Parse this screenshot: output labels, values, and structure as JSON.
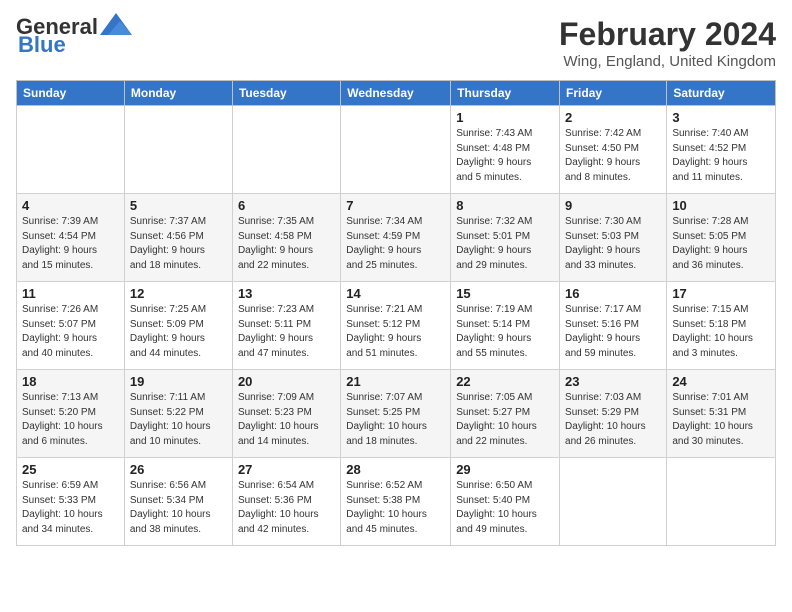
{
  "header": {
    "logo_line1": "General",
    "logo_line2": "Blue",
    "month_title": "February 2024",
    "location": "Wing, England, United Kingdom"
  },
  "weekdays": [
    "Sunday",
    "Monday",
    "Tuesday",
    "Wednesday",
    "Thursday",
    "Friday",
    "Saturday"
  ],
  "weeks": [
    [
      {
        "day": "",
        "info": ""
      },
      {
        "day": "",
        "info": ""
      },
      {
        "day": "",
        "info": ""
      },
      {
        "day": "",
        "info": ""
      },
      {
        "day": "1",
        "info": "Sunrise: 7:43 AM\nSunset: 4:48 PM\nDaylight: 9 hours\nand 5 minutes."
      },
      {
        "day": "2",
        "info": "Sunrise: 7:42 AM\nSunset: 4:50 PM\nDaylight: 9 hours\nand 8 minutes."
      },
      {
        "day": "3",
        "info": "Sunrise: 7:40 AM\nSunset: 4:52 PM\nDaylight: 9 hours\nand 11 minutes."
      }
    ],
    [
      {
        "day": "4",
        "info": "Sunrise: 7:39 AM\nSunset: 4:54 PM\nDaylight: 9 hours\nand 15 minutes."
      },
      {
        "day": "5",
        "info": "Sunrise: 7:37 AM\nSunset: 4:56 PM\nDaylight: 9 hours\nand 18 minutes."
      },
      {
        "day": "6",
        "info": "Sunrise: 7:35 AM\nSunset: 4:58 PM\nDaylight: 9 hours\nand 22 minutes."
      },
      {
        "day": "7",
        "info": "Sunrise: 7:34 AM\nSunset: 4:59 PM\nDaylight: 9 hours\nand 25 minutes."
      },
      {
        "day": "8",
        "info": "Sunrise: 7:32 AM\nSunset: 5:01 PM\nDaylight: 9 hours\nand 29 minutes."
      },
      {
        "day": "9",
        "info": "Sunrise: 7:30 AM\nSunset: 5:03 PM\nDaylight: 9 hours\nand 33 minutes."
      },
      {
        "day": "10",
        "info": "Sunrise: 7:28 AM\nSunset: 5:05 PM\nDaylight: 9 hours\nand 36 minutes."
      }
    ],
    [
      {
        "day": "11",
        "info": "Sunrise: 7:26 AM\nSunset: 5:07 PM\nDaylight: 9 hours\nand 40 minutes."
      },
      {
        "day": "12",
        "info": "Sunrise: 7:25 AM\nSunset: 5:09 PM\nDaylight: 9 hours\nand 44 minutes."
      },
      {
        "day": "13",
        "info": "Sunrise: 7:23 AM\nSunset: 5:11 PM\nDaylight: 9 hours\nand 47 minutes."
      },
      {
        "day": "14",
        "info": "Sunrise: 7:21 AM\nSunset: 5:12 PM\nDaylight: 9 hours\nand 51 minutes."
      },
      {
        "day": "15",
        "info": "Sunrise: 7:19 AM\nSunset: 5:14 PM\nDaylight: 9 hours\nand 55 minutes."
      },
      {
        "day": "16",
        "info": "Sunrise: 7:17 AM\nSunset: 5:16 PM\nDaylight: 9 hours\nand 59 minutes."
      },
      {
        "day": "17",
        "info": "Sunrise: 7:15 AM\nSunset: 5:18 PM\nDaylight: 10 hours\nand 3 minutes."
      }
    ],
    [
      {
        "day": "18",
        "info": "Sunrise: 7:13 AM\nSunset: 5:20 PM\nDaylight: 10 hours\nand 6 minutes."
      },
      {
        "day": "19",
        "info": "Sunrise: 7:11 AM\nSunset: 5:22 PM\nDaylight: 10 hours\nand 10 minutes."
      },
      {
        "day": "20",
        "info": "Sunrise: 7:09 AM\nSunset: 5:23 PM\nDaylight: 10 hours\nand 14 minutes."
      },
      {
        "day": "21",
        "info": "Sunrise: 7:07 AM\nSunset: 5:25 PM\nDaylight: 10 hours\nand 18 minutes."
      },
      {
        "day": "22",
        "info": "Sunrise: 7:05 AM\nSunset: 5:27 PM\nDaylight: 10 hours\nand 22 minutes."
      },
      {
        "day": "23",
        "info": "Sunrise: 7:03 AM\nSunset: 5:29 PM\nDaylight: 10 hours\nand 26 minutes."
      },
      {
        "day": "24",
        "info": "Sunrise: 7:01 AM\nSunset: 5:31 PM\nDaylight: 10 hours\nand 30 minutes."
      }
    ],
    [
      {
        "day": "25",
        "info": "Sunrise: 6:59 AM\nSunset: 5:33 PM\nDaylight: 10 hours\nand 34 minutes."
      },
      {
        "day": "26",
        "info": "Sunrise: 6:56 AM\nSunset: 5:34 PM\nDaylight: 10 hours\nand 38 minutes."
      },
      {
        "day": "27",
        "info": "Sunrise: 6:54 AM\nSunset: 5:36 PM\nDaylight: 10 hours\nand 42 minutes."
      },
      {
        "day": "28",
        "info": "Sunrise: 6:52 AM\nSunset: 5:38 PM\nDaylight: 10 hours\nand 45 minutes."
      },
      {
        "day": "29",
        "info": "Sunrise: 6:50 AM\nSunset: 5:40 PM\nDaylight: 10 hours\nand 49 minutes."
      },
      {
        "day": "",
        "info": ""
      },
      {
        "day": "",
        "info": ""
      }
    ]
  ]
}
